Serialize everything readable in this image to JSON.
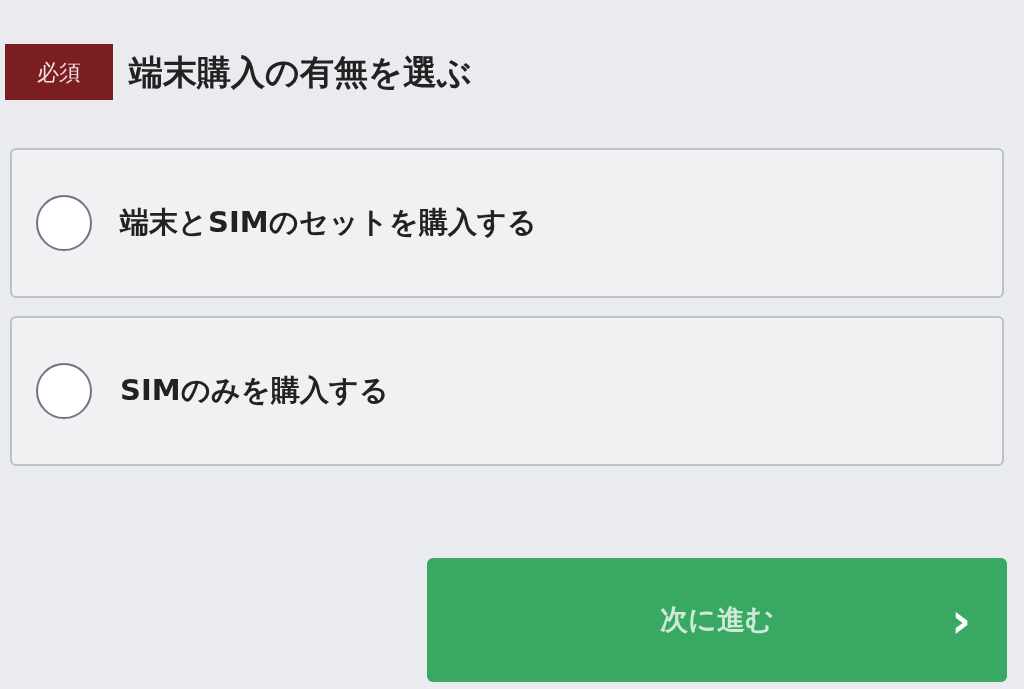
{
  "question": {
    "badge": "必須",
    "title": "端末購入の有無を選ぶ"
  },
  "options": [
    {
      "label": "端末とSIMのセットを購入する",
      "selected": false
    },
    {
      "label": "SIMのみを購入する",
      "selected": false
    }
  ],
  "next_button": {
    "label": "次に進む",
    "chevron": "›"
  }
}
